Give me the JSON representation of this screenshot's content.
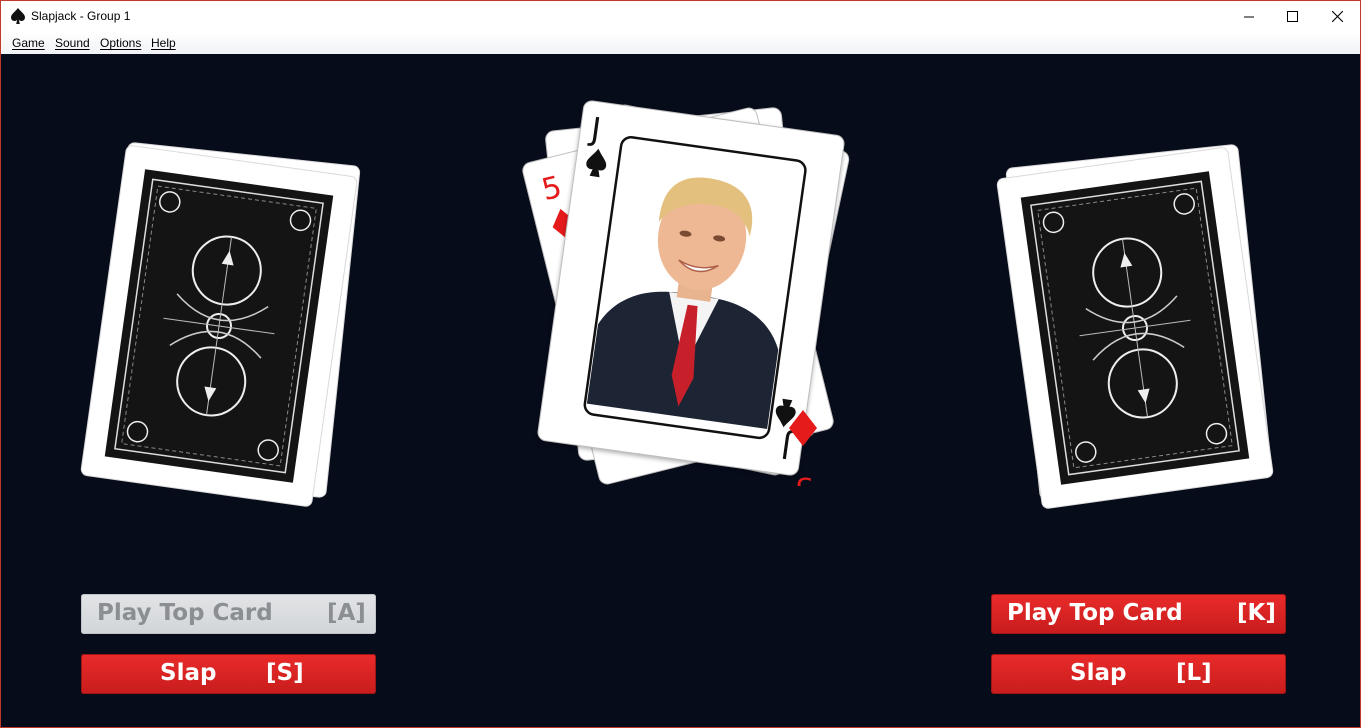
{
  "window": {
    "title": "Slapjack - Group 1",
    "controls": [
      "minimize",
      "maximize",
      "close"
    ]
  },
  "menu": [
    "Game",
    "Sound",
    "Options",
    "Help"
  ],
  "table": {
    "background_color": "#070c1b",
    "left_deck": {
      "face": "down",
      "back_style": "black-ornate"
    },
    "right_deck": {
      "face": "down",
      "back_style": "black-ornate"
    },
    "center_pile": {
      "top_card": {
        "rank": "J",
        "suit": "spades",
        "art": "portrait-photo"
      },
      "under_card": {
        "rank": "5",
        "suit": "diamonds"
      }
    }
  },
  "player_left": {
    "play_button": {
      "label": "Play Top Card",
      "key": "[A]",
      "enabled": false
    },
    "slap_button": {
      "label": "Slap",
      "key": "[S]",
      "enabled": true
    }
  },
  "player_right": {
    "play_button": {
      "label": "Play Top Card",
      "key": "[K]",
      "enabled": true
    },
    "slap_button": {
      "label": "Slap",
      "key": "[L]",
      "enabled": true
    }
  },
  "colors": {
    "button_red": "#d92323",
    "button_disabled": "#d8dadd",
    "suit_red": "#e51b1b"
  }
}
